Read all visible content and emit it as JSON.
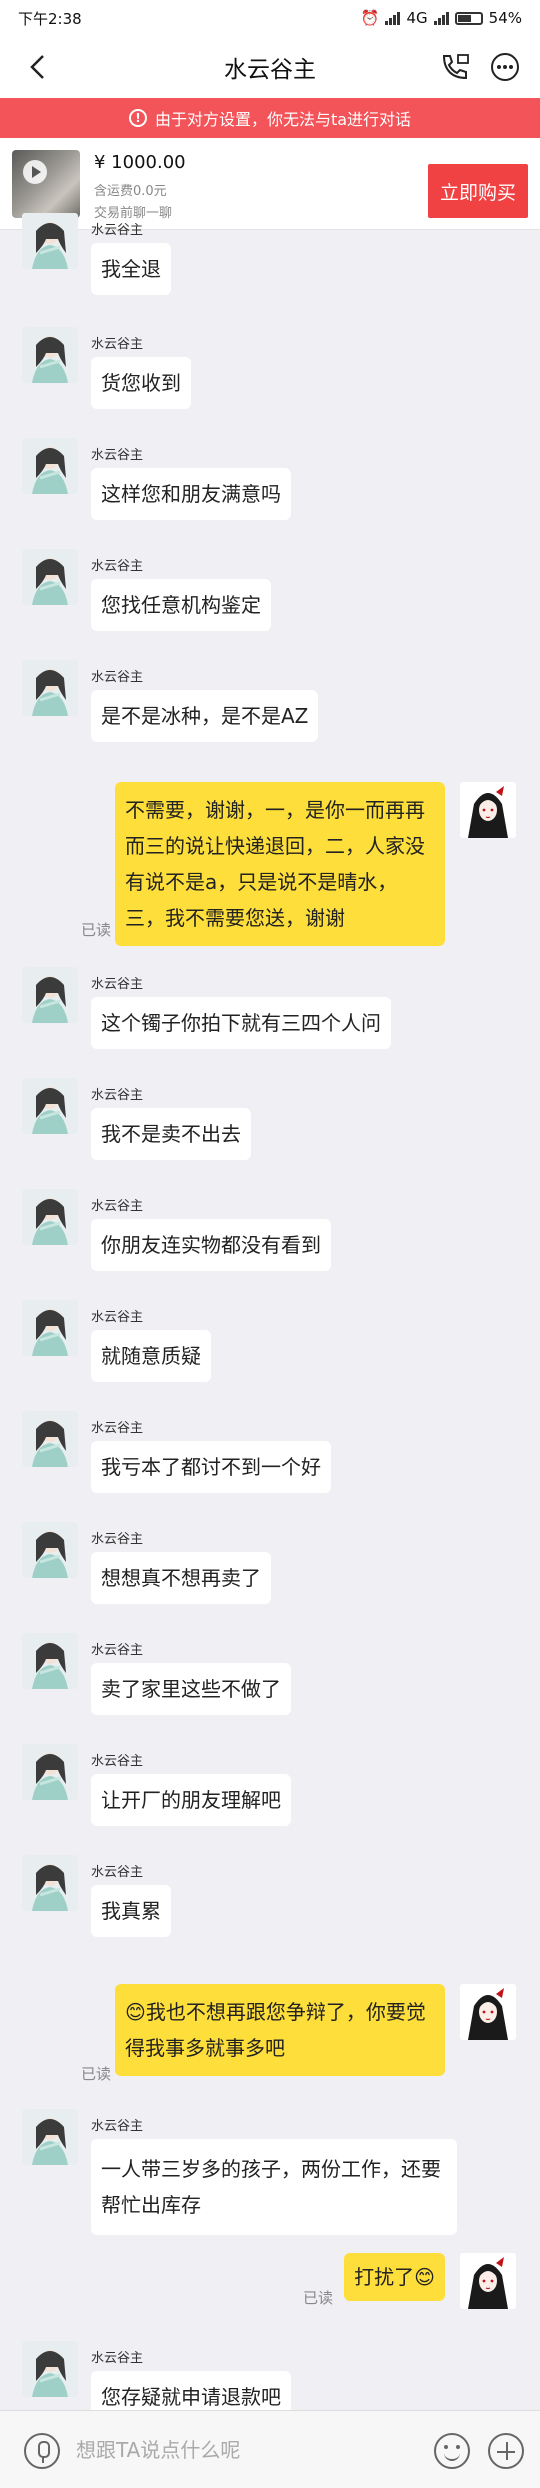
{
  "status_bar": {
    "time": "下午2:38",
    "network": "4G",
    "battery": "54%"
  },
  "header": {
    "title": "水云谷主"
  },
  "banner": {
    "text": "由于对方设置，你无法与ta进行对话"
  },
  "product": {
    "price": "¥ 1000.00",
    "shipping": "含运费0.0元",
    "note": "交易前聊一聊",
    "buy_label": "立即购买"
  },
  "contact_name": "水云谷主",
  "read_label": "已读",
  "messages": [
    {
      "from": "them",
      "text": "我全退"
    },
    {
      "from": "them",
      "text": "货您收到"
    },
    {
      "from": "them",
      "text": "这样您和朋友满意吗"
    },
    {
      "from": "them",
      "text": "您找任意机构鉴定"
    },
    {
      "from": "them",
      "text": "是不是冰种，是不是AZ"
    },
    {
      "from": "me",
      "text": "不需要，谢谢，一，是你一而再再而三的说让快递退回，二，人家没有说不是a，只是说不是晴水，三，我不需要您送，谢谢",
      "read": "已读"
    },
    {
      "from": "them",
      "text": "这个镯子你拍下就有三四个人问"
    },
    {
      "from": "them",
      "text": "我不是卖不出去"
    },
    {
      "from": "them",
      "text": "你朋友连实物都没有看到"
    },
    {
      "from": "them",
      "text": "就随意质疑"
    },
    {
      "from": "them",
      "text": "我亏本了都讨不到一个好"
    },
    {
      "from": "them",
      "text": "想想真不想再卖了"
    },
    {
      "from": "them",
      "text": "卖了家里这些不做了"
    },
    {
      "from": "them",
      "text": "让开厂的朋友理解吧"
    },
    {
      "from": "them",
      "text": "我真累"
    },
    {
      "from": "me",
      "text": "😊我也不想再跟您争辩了，你要觉得我事多就事多吧",
      "read": "已读"
    },
    {
      "from": "them",
      "text": "一人带三岁多的孩子，两份工作，还要帮忙出库存"
    },
    {
      "from": "me",
      "text": "打扰了😊",
      "read": "已读"
    },
    {
      "from": "them",
      "text": "您存疑就申请退款吧"
    }
  ],
  "input": {
    "placeholder": "想跟TA说点什么呢"
  }
}
